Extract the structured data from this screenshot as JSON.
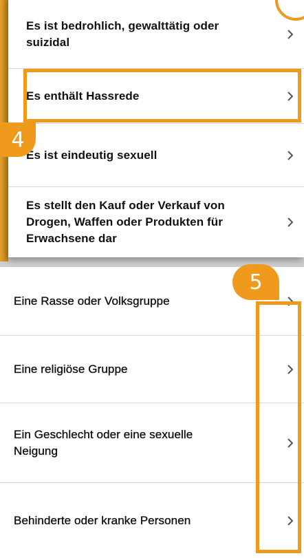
{
  "colors": {
    "highlight": "#ef9a1c",
    "text": "#111111",
    "divider": "#d8d8d8"
  },
  "menu_top": {
    "items": [
      {
        "label": "Es ist bedrohlich, gewalttätig oder suizidal"
      },
      {
        "label": "Es enthält Hassrede"
      },
      {
        "label": "Es ist eindeutig sexuell"
      },
      {
        "label": "Es stellt den Kauf oder Verkauf von Drogen, Waffen oder Produkten für Erwachsene dar"
      }
    ]
  },
  "menu_bottom": {
    "items": [
      {
        "label": "Eine Rasse oder Volksgruppe"
      },
      {
        "label": "Eine religiöse Gruppe"
      },
      {
        "label": "Ein Geschlecht oder eine sexuelle Neigung"
      },
      {
        "label": "Behinderte oder kranke Personen"
      }
    ]
  },
  "annotations": {
    "step4": "4",
    "step5": "5"
  },
  "icons": {
    "row_chevron": "chevron-right-icon"
  }
}
